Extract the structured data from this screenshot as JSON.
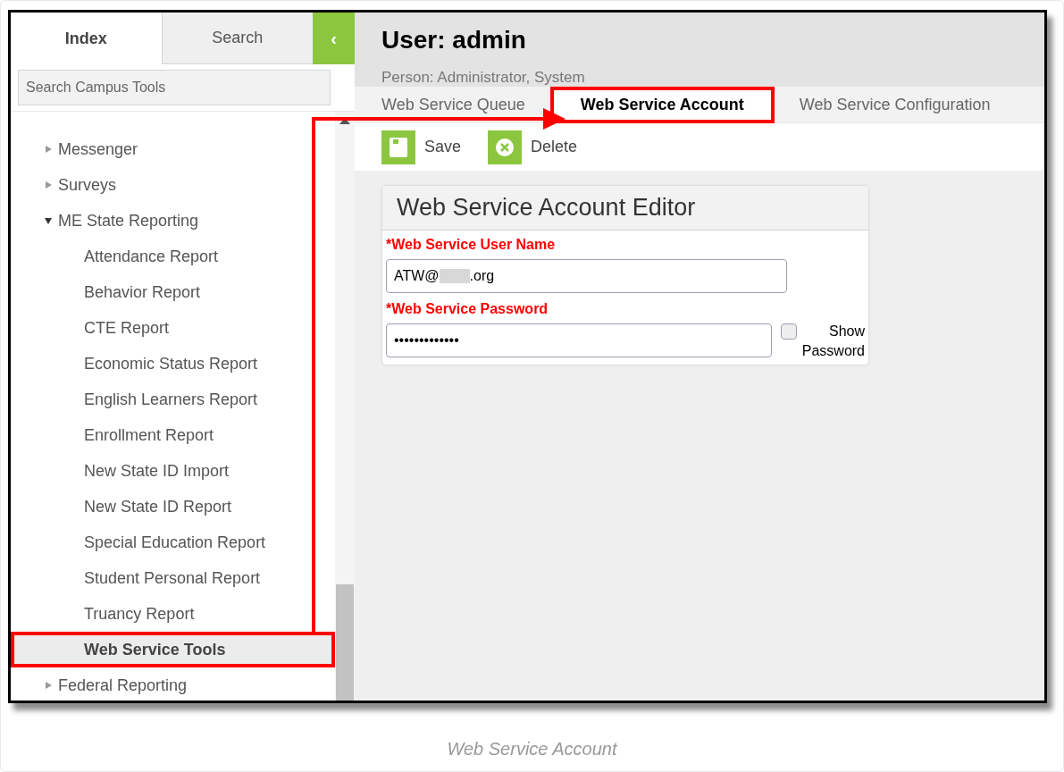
{
  "sidebar": {
    "tabs": [
      {
        "label": "Index",
        "selected": true
      },
      {
        "label": "Search",
        "selected": false
      }
    ],
    "collapse_button": {
      "label": "‹"
    },
    "search": {
      "placeholder": "Search Campus Tools"
    },
    "tree": [
      {
        "label": "Messenger",
        "expanded": false,
        "selected": false,
        "highlighted": false
      },
      {
        "label": "Surveys",
        "expanded": false,
        "selected": false,
        "highlighted": false
      },
      {
        "label": "ME State Reporting",
        "expanded": true,
        "selected": false,
        "highlighted": false,
        "children": [
          {
            "label": "Attendance Report",
            "selected": false,
            "highlighted": false
          },
          {
            "label": "Behavior Report",
            "selected": false,
            "highlighted": false
          },
          {
            "label": "CTE Report",
            "selected": false,
            "highlighted": false
          },
          {
            "label": "Economic Status Report",
            "selected": false,
            "highlighted": false
          },
          {
            "label": "English Learners Report",
            "selected": false,
            "highlighted": false
          },
          {
            "label": "Enrollment Report",
            "selected": false,
            "highlighted": false
          },
          {
            "label": "New State ID Import",
            "selected": false,
            "highlighted": false
          },
          {
            "label": "New State ID Report",
            "selected": false,
            "highlighted": false
          },
          {
            "label": "Special Education Report",
            "selected": false,
            "highlighted": false
          },
          {
            "label": "Student Personal Report",
            "selected": false,
            "highlighted": false
          },
          {
            "label": "Truancy Report",
            "selected": false,
            "highlighted": false
          },
          {
            "label": "Web Service Tools",
            "selected": true,
            "highlighted": true
          }
        ]
      },
      {
        "label": "Federal Reporting",
        "expanded": false,
        "selected": false,
        "highlighted": false
      }
    ]
  },
  "header": {
    "title": "User: admin",
    "subtitle": "Person: Administrator, System"
  },
  "tabs": [
    {
      "label": "Web Service Queue",
      "selected": false,
      "highlighted": false
    },
    {
      "label": "Web Service Account",
      "selected": true,
      "highlighted": true
    },
    {
      "label": "Web Service Configuration",
      "selected": false,
      "highlighted": false
    }
  ],
  "toolbar": [
    {
      "kind": "save",
      "label": "Save"
    },
    {
      "kind": "delete",
      "label": "Delete"
    }
  ],
  "editor": {
    "title": "Web Service Account Editor",
    "user_name": {
      "label": "*Web Service User Name",
      "value_start": "ATW@",
      "value_end": ".org"
    },
    "password": {
      "label": "*Web Service Password",
      "value": "•••••••••••••"
    },
    "show_password": {
      "label": "Show Password",
      "checked": false
    }
  },
  "caption": "Web Service Account"
}
